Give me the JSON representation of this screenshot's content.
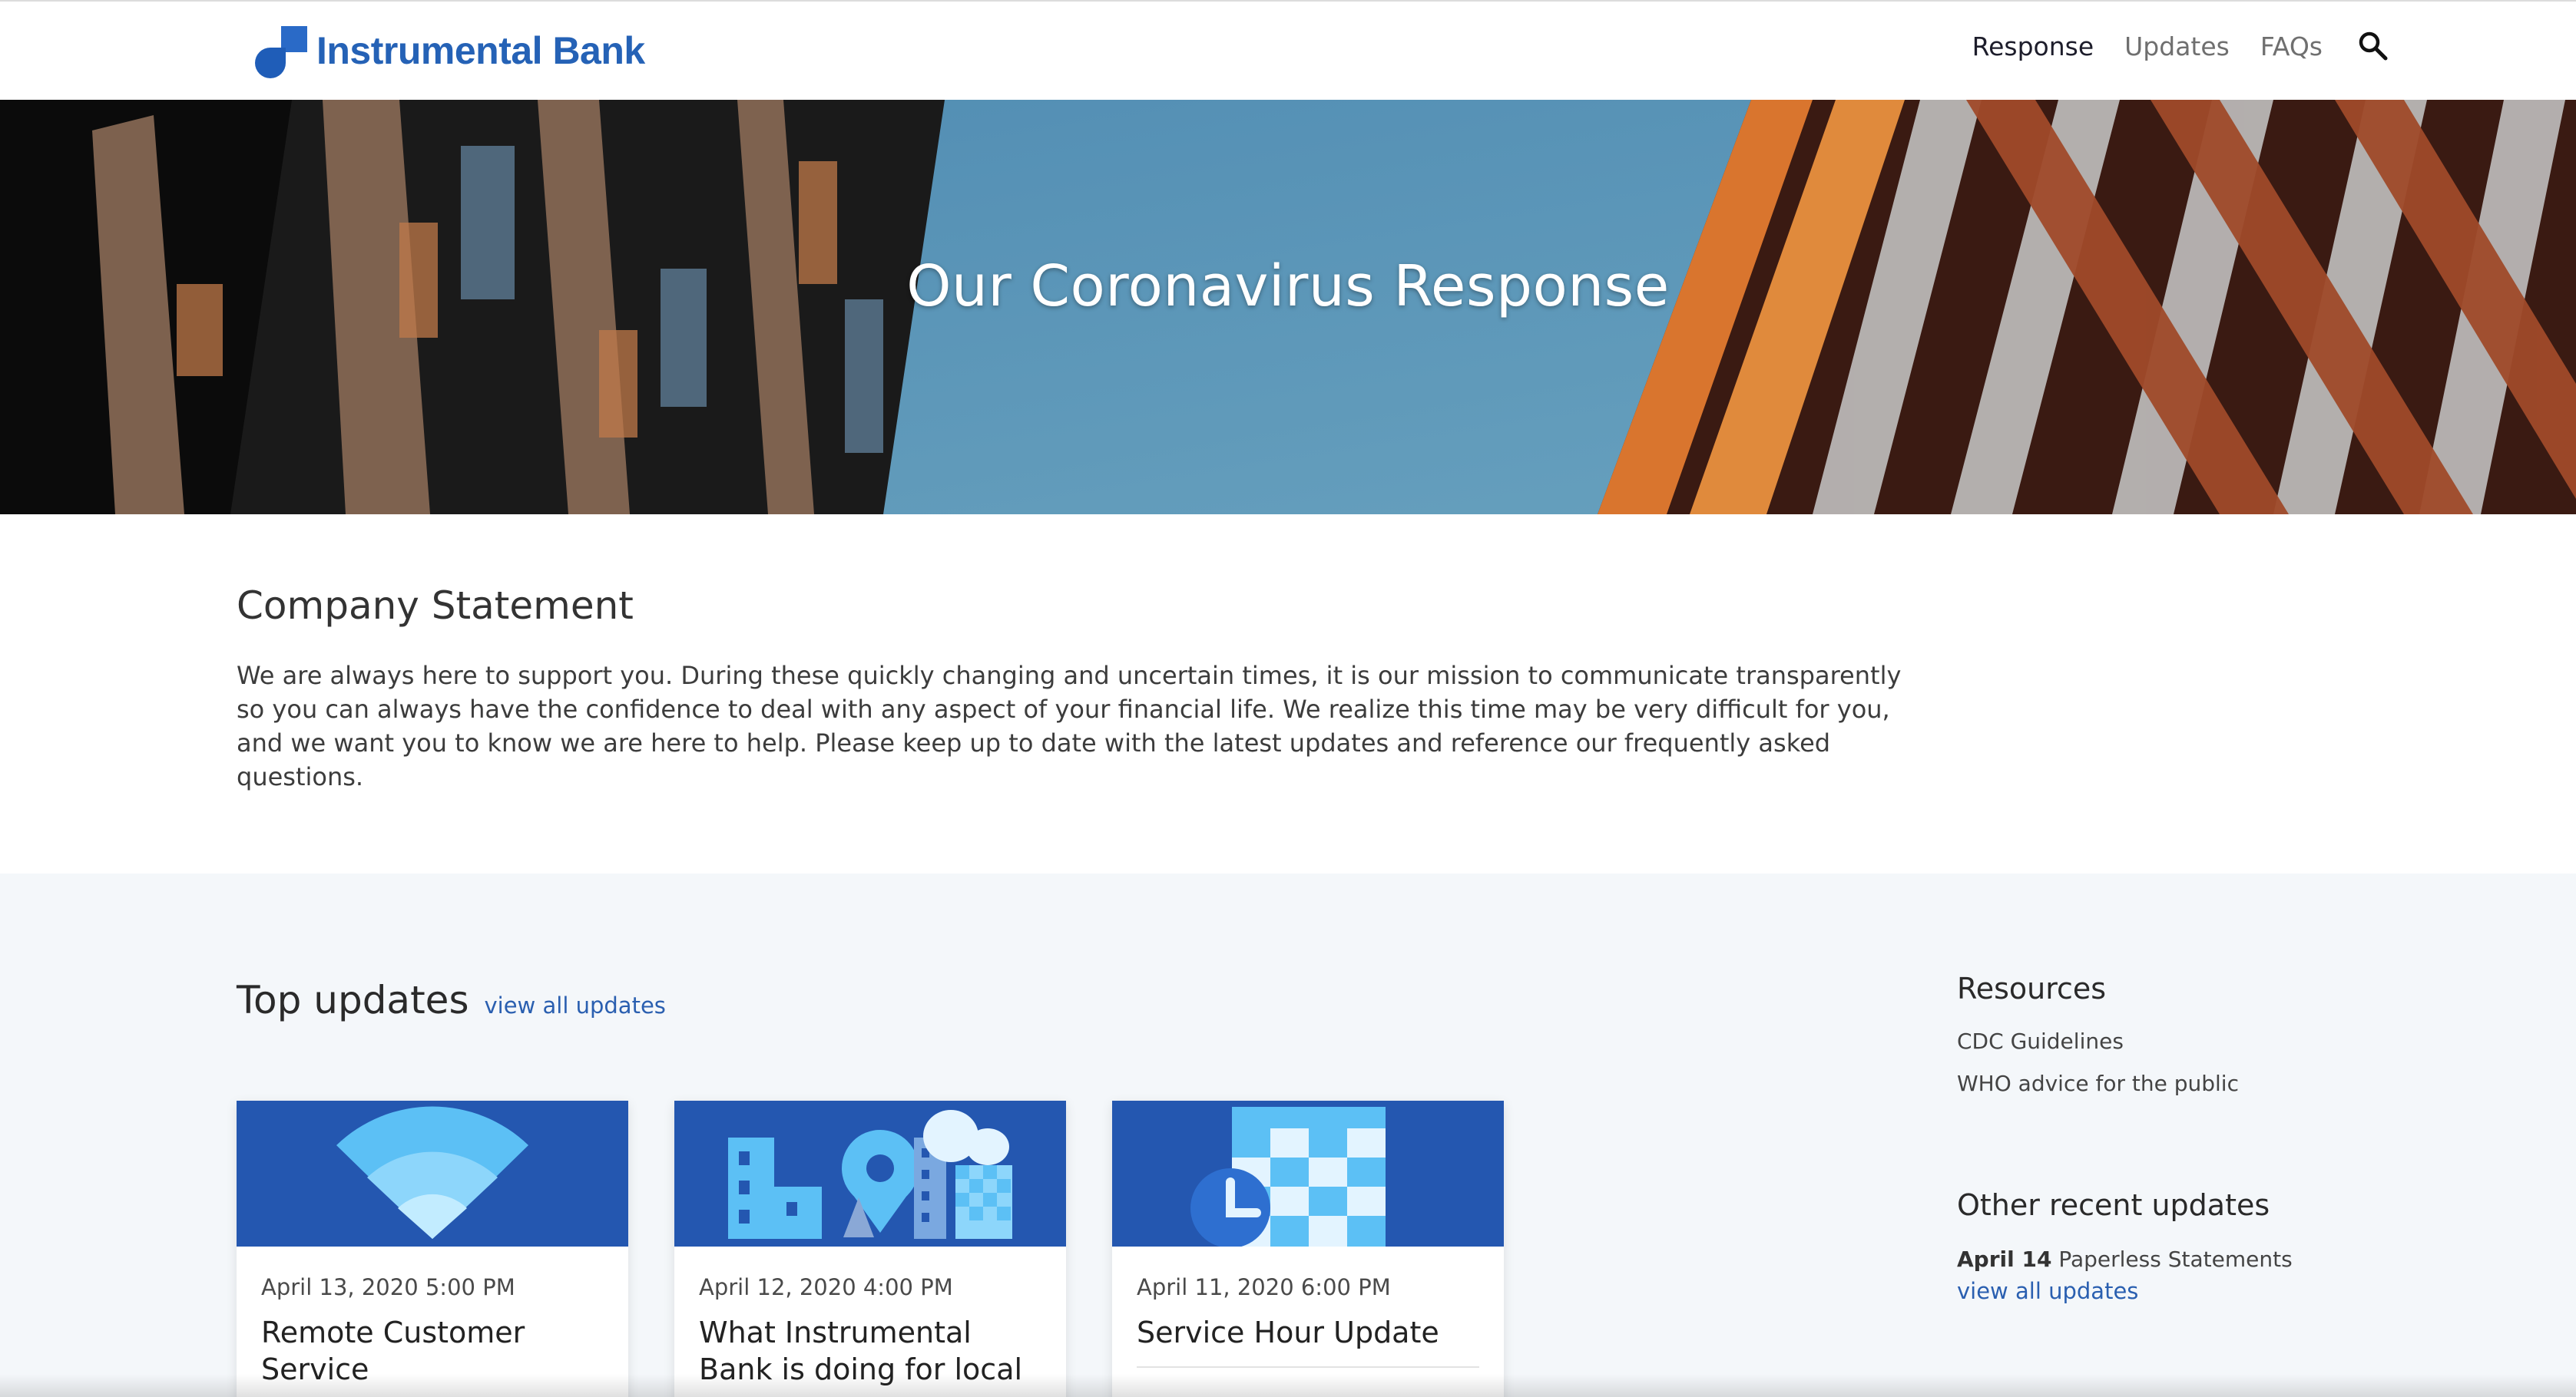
{
  "brand": {
    "name": "Instrumental Bank",
    "color": "#2562b6"
  },
  "nav": {
    "items": [
      {
        "label": "Response",
        "active": true
      },
      {
        "label": "Updates",
        "active": false
      },
      {
        "label": "FAQs",
        "active": false
      }
    ],
    "search_icon": "search-icon"
  },
  "hero": {
    "title": "Our Coronavirus Response"
  },
  "statement": {
    "heading": "Company Statement",
    "body": "We are always here to support you. During these quickly changing and uncertain times, it is our mission to communicate transparently so you can always have the confidence to deal with any aspect of your financial life. We realize this time may be very difficult for you, and we want you to know we are here to help. Please keep up to date with the latest updates and reference our frequently asked questions."
  },
  "top_updates": {
    "heading": "Top updates",
    "view_all": "view all updates",
    "cards": [
      {
        "date": "April 13, 2020 5:00 PM",
        "title": "Remote Customer Service",
        "icon": "wifi-icon"
      },
      {
        "date": "April 12, 2020 4:00 PM",
        "title": "What Instrumental Bank is doing for local",
        "icon": "city-location-icon"
      },
      {
        "date": "April 11, 2020 6:00 PM",
        "title": "Service Hour Update",
        "icon": "clock-calendar-icon"
      }
    ]
  },
  "sidebar": {
    "resources_heading": "Resources",
    "resources": [
      "CDC Guidelines",
      "WHO advice for the public"
    ],
    "other_heading": "Other recent updates",
    "recent": {
      "date": "April 14",
      "title": "Paperless Statements"
    },
    "view_all": "view all updates"
  },
  "colors": {
    "accent": "#2a5fb0",
    "card_header": "#2457b0",
    "section_bg": "#f4f7fa"
  }
}
